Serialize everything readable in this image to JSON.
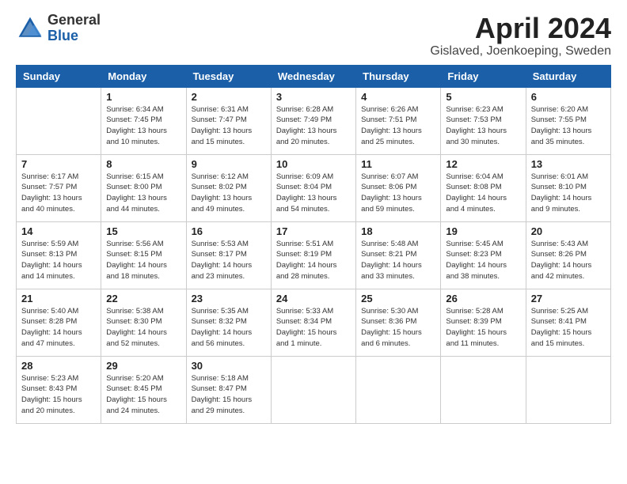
{
  "header": {
    "logo_general": "General",
    "logo_blue": "Blue",
    "month_title": "April 2024",
    "subtitle": "Gislaved, Joenkoeping, Sweden"
  },
  "days_of_week": [
    "Sunday",
    "Monday",
    "Tuesday",
    "Wednesday",
    "Thursday",
    "Friday",
    "Saturday"
  ],
  "weeks": [
    [
      {
        "day": "",
        "sunrise": "",
        "sunset": "",
        "daylight": ""
      },
      {
        "day": "1",
        "sunrise": "Sunrise: 6:34 AM",
        "sunset": "Sunset: 7:45 PM",
        "daylight": "Daylight: 13 hours and 10 minutes."
      },
      {
        "day": "2",
        "sunrise": "Sunrise: 6:31 AM",
        "sunset": "Sunset: 7:47 PM",
        "daylight": "Daylight: 13 hours and 15 minutes."
      },
      {
        "day": "3",
        "sunrise": "Sunrise: 6:28 AM",
        "sunset": "Sunset: 7:49 PM",
        "daylight": "Daylight: 13 hours and 20 minutes."
      },
      {
        "day": "4",
        "sunrise": "Sunrise: 6:26 AM",
        "sunset": "Sunset: 7:51 PM",
        "daylight": "Daylight: 13 hours and 25 minutes."
      },
      {
        "day": "5",
        "sunrise": "Sunrise: 6:23 AM",
        "sunset": "Sunset: 7:53 PM",
        "daylight": "Daylight: 13 hours and 30 minutes."
      },
      {
        "day": "6",
        "sunrise": "Sunrise: 6:20 AM",
        "sunset": "Sunset: 7:55 PM",
        "daylight": "Daylight: 13 hours and 35 minutes."
      }
    ],
    [
      {
        "day": "7",
        "sunrise": "Sunrise: 6:17 AM",
        "sunset": "Sunset: 7:57 PM",
        "daylight": "Daylight: 13 hours and 40 minutes."
      },
      {
        "day": "8",
        "sunrise": "Sunrise: 6:15 AM",
        "sunset": "Sunset: 8:00 PM",
        "daylight": "Daylight: 13 hours and 44 minutes."
      },
      {
        "day": "9",
        "sunrise": "Sunrise: 6:12 AM",
        "sunset": "Sunset: 8:02 PM",
        "daylight": "Daylight: 13 hours and 49 minutes."
      },
      {
        "day": "10",
        "sunrise": "Sunrise: 6:09 AM",
        "sunset": "Sunset: 8:04 PM",
        "daylight": "Daylight: 13 hours and 54 minutes."
      },
      {
        "day": "11",
        "sunrise": "Sunrise: 6:07 AM",
        "sunset": "Sunset: 8:06 PM",
        "daylight": "Daylight: 13 hours and 59 minutes."
      },
      {
        "day": "12",
        "sunrise": "Sunrise: 6:04 AM",
        "sunset": "Sunset: 8:08 PM",
        "daylight": "Daylight: 14 hours and 4 minutes."
      },
      {
        "day": "13",
        "sunrise": "Sunrise: 6:01 AM",
        "sunset": "Sunset: 8:10 PM",
        "daylight": "Daylight: 14 hours and 9 minutes."
      }
    ],
    [
      {
        "day": "14",
        "sunrise": "Sunrise: 5:59 AM",
        "sunset": "Sunset: 8:13 PM",
        "daylight": "Daylight: 14 hours and 14 minutes."
      },
      {
        "day": "15",
        "sunrise": "Sunrise: 5:56 AM",
        "sunset": "Sunset: 8:15 PM",
        "daylight": "Daylight: 14 hours and 18 minutes."
      },
      {
        "day": "16",
        "sunrise": "Sunrise: 5:53 AM",
        "sunset": "Sunset: 8:17 PM",
        "daylight": "Daylight: 14 hours and 23 minutes."
      },
      {
        "day": "17",
        "sunrise": "Sunrise: 5:51 AM",
        "sunset": "Sunset: 8:19 PM",
        "daylight": "Daylight: 14 hours and 28 minutes."
      },
      {
        "day": "18",
        "sunrise": "Sunrise: 5:48 AM",
        "sunset": "Sunset: 8:21 PM",
        "daylight": "Daylight: 14 hours and 33 minutes."
      },
      {
        "day": "19",
        "sunrise": "Sunrise: 5:45 AM",
        "sunset": "Sunset: 8:23 PM",
        "daylight": "Daylight: 14 hours and 38 minutes."
      },
      {
        "day": "20",
        "sunrise": "Sunrise: 5:43 AM",
        "sunset": "Sunset: 8:26 PM",
        "daylight": "Daylight: 14 hours and 42 minutes."
      }
    ],
    [
      {
        "day": "21",
        "sunrise": "Sunrise: 5:40 AM",
        "sunset": "Sunset: 8:28 PM",
        "daylight": "Daylight: 14 hours and 47 minutes."
      },
      {
        "day": "22",
        "sunrise": "Sunrise: 5:38 AM",
        "sunset": "Sunset: 8:30 PM",
        "daylight": "Daylight: 14 hours and 52 minutes."
      },
      {
        "day": "23",
        "sunrise": "Sunrise: 5:35 AM",
        "sunset": "Sunset: 8:32 PM",
        "daylight": "Daylight: 14 hours and 56 minutes."
      },
      {
        "day": "24",
        "sunrise": "Sunrise: 5:33 AM",
        "sunset": "Sunset: 8:34 PM",
        "daylight": "Daylight: 15 hours and 1 minute."
      },
      {
        "day": "25",
        "sunrise": "Sunrise: 5:30 AM",
        "sunset": "Sunset: 8:36 PM",
        "daylight": "Daylight: 15 hours and 6 minutes."
      },
      {
        "day": "26",
        "sunrise": "Sunrise: 5:28 AM",
        "sunset": "Sunset: 8:39 PM",
        "daylight": "Daylight: 15 hours and 11 minutes."
      },
      {
        "day": "27",
        "sunrise": "Sunrise: 5:25 AM",
        "sunset": "Sunset: 8:41 PM",
        "daylight": "Daylight: 15 hours and 15 minutes."
      }
    ],
    [
      {
        "day": "28",
        "sunrise": "Sunrise: 5:23 AM",
        "sunset": "Sunset: 8:43 PM",
        "daylight": "Daylight: 15 hours and 20 minutes."
      },
      {
        "day": "29",
        "sunrise": "Sunrise: 5:20 AM",
        "sunset": "Sunset: 8:45 PM",
        "daylight": "Daylight: 15 hours and 24 minutes."
      },
      {
        "day": "30",
        "sunrise": "Sunrise: 5:18 AM",
        "sunset": "Sunset: 8:47 PM",
        "daylight": "Daylight: 15 hours and 29 minutes."
      },
      {
        "day": "",
        "sunrise": "",
        "sunset": "",
        "daylight": ""
      },
      {
        "day": "",
        "sunrise": "",
        "sunset": "",
        "daylight": ""
      },
      {
        "day": "",
        "sunrise": "",
        "sunset": "",
        "daylight": ""
      },
      {
        "day": "",
        "sunrise": "",
        "sunset": "",
        "daylight": ""
      }
    ]
  ]
}
